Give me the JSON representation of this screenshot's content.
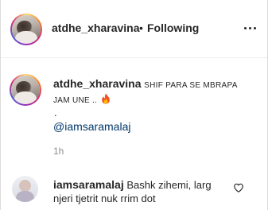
{
  "header": {
    "username": "atdhe_xharavina",
    "separator": "•",
    "follow_status": "Following",
    "more_icon": "more-horizontal-icon"
  },
  "caption": {
    "username": "atdhe_xharavina",
    "text_line1": "Shif para se mbrapa",
    "text_line2": "jam une ..",
    "emoji": "fire-emoji",
    "period": ".",
    "mention": "@iamsaramalaj",
    "time": "1h"
  },
  "comment": {
    "username": "iamsaramalaj",
    "text_line1": "Bashk zihemi, larg",
    "text_line2": "njeri tjetrit nuk rrim dot",
    "like_icon": "heart-outline-icon"
  },
  "colors": {
    "text": "#262626",
    "secondary": "#8e8e8e",
    "link": "#00376b",
    "divider": "#efefef",
    "border": "#dbdbdb"
  }
}
